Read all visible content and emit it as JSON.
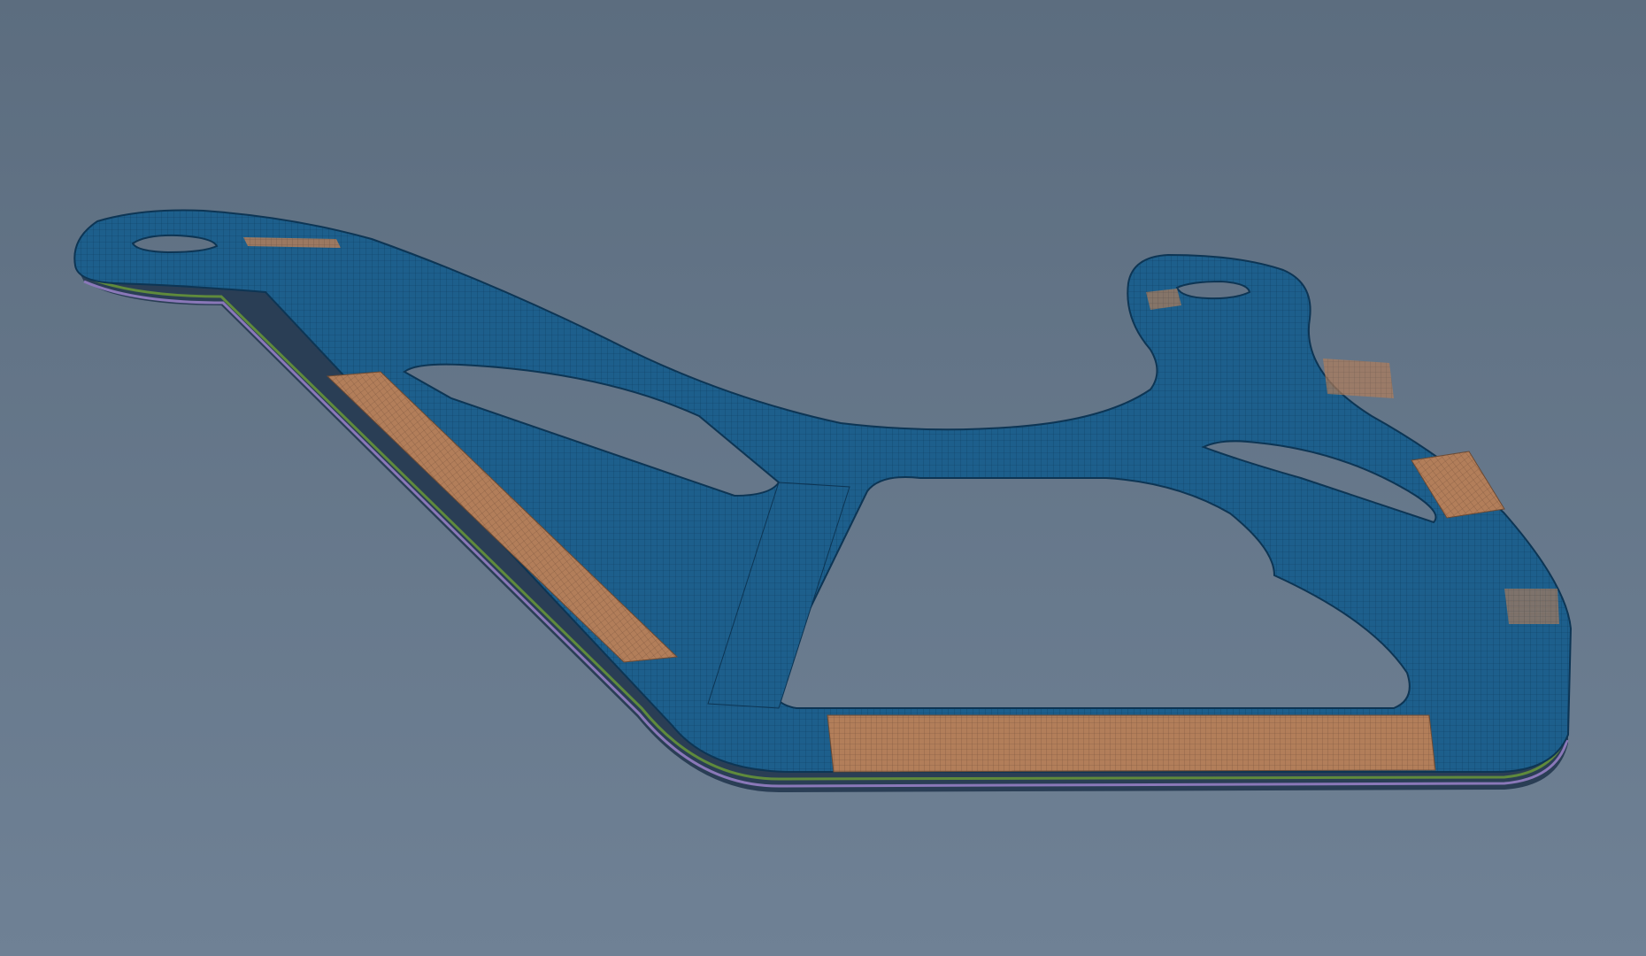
{
  "viewport": {
    "background_top": "#5c6d7f",
    "background_bottom": "#6f8195"
  },
  "model": {
    "element_color": "#1d5f8c",
    "mesh_line_color": "#0f3f63",
    "thin_section_color": "#b27e5a",
    "thin_mesh_line_color": "#7c553d",
    "layer_green": "#5f8a3c",
    "layer_purple": "#8a78b8",
    "layer_dark": "#2a3e55",
    "hole_color": "#8c9bab"
  }
}
